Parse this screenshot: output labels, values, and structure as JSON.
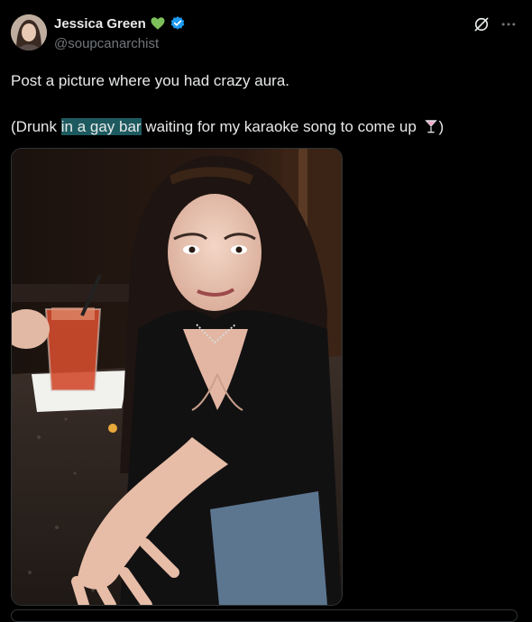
{
  "author": {
    "display_name": "Jessica Green",
    "handle": "@soupcanarchist",
    "heart_color": "#7cc05a",
    "verified_color": "#1d9bf0"
  },
  "tweet": {
    "line1": "Post a picture where you had crazy aura.",
    "line2_prefix": "(Drunk ",
    "line2_highlight": "in a gay bar",
    "line2_suffix": " waiting for my karaoke song to come up ",
    "line2_end": ")"
  },
  "icons": {
    "grok": "grok-icon",
    "more": "more-icon",
    "heart": "green-heart-icon",
    "verified": "verified-badge-icon",
    "cocktail": "cocktail-glass-icon"
  },
  "colors": {
    "background": "#000000",
    "text": "#e7e9ea",
    "secondary": "#71767b",
    "highlight": "#1d5a5f"
  }
}
